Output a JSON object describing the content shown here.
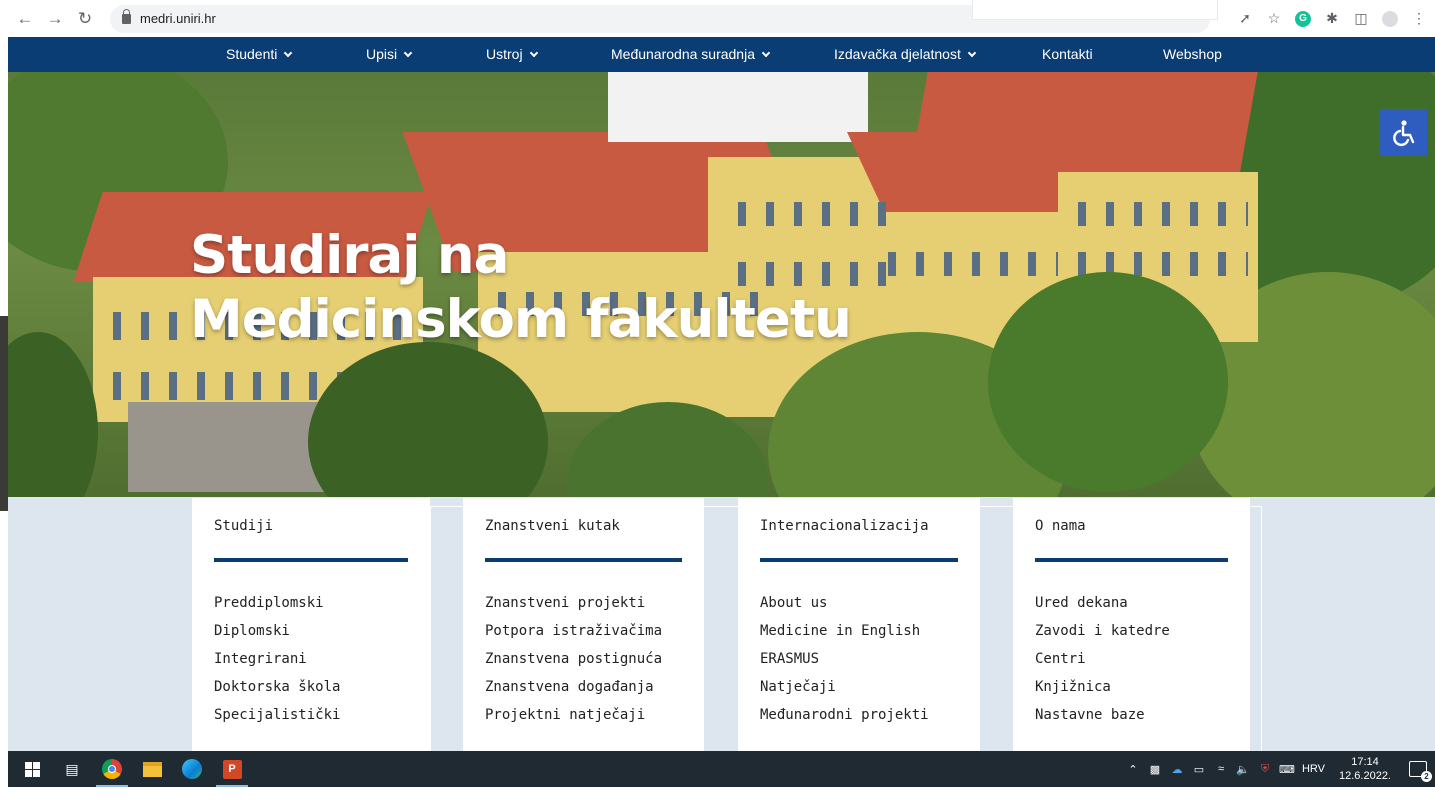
{
  "browser": {
    "url": "medri.uniri.hr"
  },
  "nav": {
    "items": [
      {
        "label": "Studenti",
        "dropdown": true
      },
      {
        "label": "Upisi",
        "dropdown": true
      },
      {
        "label": "Ustroj",
        "dropdown": true
      },
      {
        "label": "Međunarodna suradnja",
        "dropdown": true
      },
      {
        "label": "Izdavačka djelatnost",
        "dropdown": true
      },
      {
        "label": "Kontakti",
        "dropdown": false
      },
      {
        "label": "Webshop",
        "dropdown": false
      }
    ]
  },
  "hero": {
    "title_line1": "Studiraj na",
    "title_line2": "Medicinskom fakultetu"
  },
  "cards": [
    {
      "title": "Studiji",
      "links": [
        "Preddiplomski",
        "Diplomski",
        "Integrirani",
        "Doktorska škola",
        "Specijalistički"
      ]
    },
    {
      "title": "Znanstveni kutak",
      "links": [
        "Znanstveni projekti",
        "Potpora istraživačima",
        "Znanstvena postignuća",
        "Znanstvena događanja",
        "Projektni natječaji"
      ]
    },
    {
      "title": "Internacionalizacija",
      "links": [
        "About us",
        "Medicine in English",
        "ERASMUS",
        "Natječaji",
        "Međunarodni projekti"
      ]
    },
    {
      "title": "O nama",
      "links": [
        "Ured dekana",
        "Zavodi i katedre",
        "Centri",
        "Knjižnica",
        "Nastavne baze"
      ]
    }
  ],
  "taskbar": {
    "language": "HRV",
    "time": "17:14",
    "date": "12.6.2022.",
    "notification_count": "2",
    "ppt_label": "P"
  },
  "colors": {
    "nav_bg": "#0a3d73",
    "accent_rule": "#0a3d73",
    "accessibility_btn": "#2f5dbf",
    "lower_bg": "#dde6ef"
  }
}
